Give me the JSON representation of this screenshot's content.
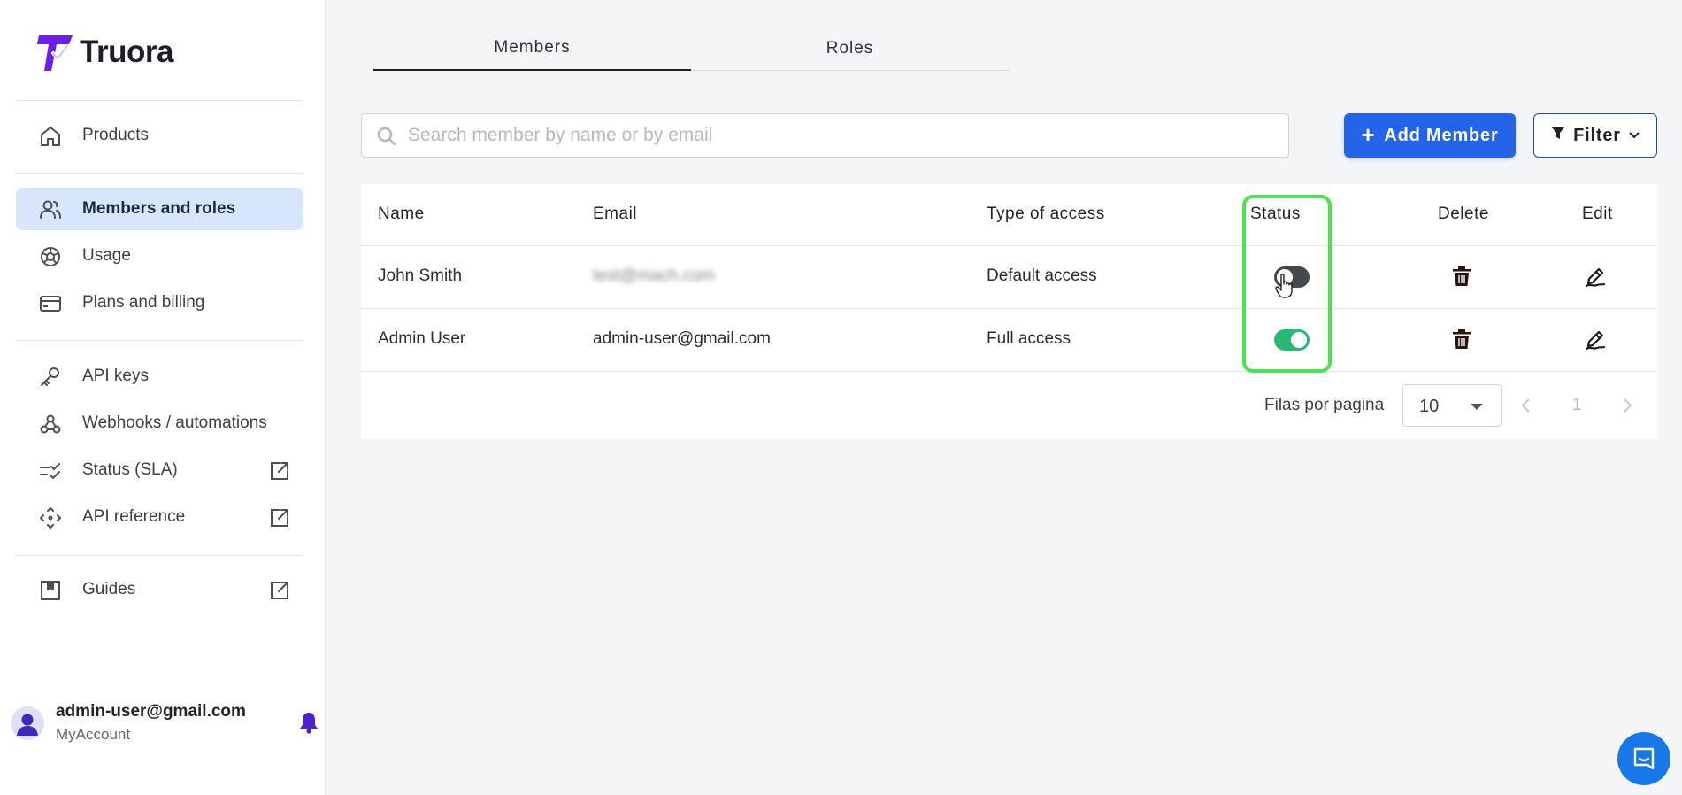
{
  "brand": {
    "name": "Truora",
    "color": "#6b1ee6"
  },
  "sidebar": {
    "items": [
      {
        "label": "Products",
        "icon": "home-icon"
      },
      {
        "label": "Members and roles",
        "icon": "users-icon",
        "active": true
      },
      {
        "label": "Usage",
        "icon": "usage-icon"
      },
      {
        "label": "Plans and billing",
        "icon": "credit-card-icon"
      },
      {
        "label": "API keys",
        "icon": "key-icon"
      },
      {
        "label": "Webhooks / automations",
        "icon": "webhook-icon"
      },
      {
        "label": "Status (SLA)",
        "icon": "checklist-icon",
        "external": true
      },
      {
        "label": "API reference",
        "icon": "api-arrows-icon",
        "external": true
      },
      {
        "label": "Guides",
        "icon": "bookmark-icon",
        "external": true
      }
    ],
    "account": {
      "email": "admin-user@gmail.com",
      "subtitle": "MyAccount"
    }
  },
  "tabs": [
    {
      "label": "Members",
      "active": true
    },
    {
      "label": "Roles",
      "active": false
    }
  ],
  "search": {
    "placeholder": "Search member by name or by email",
    "value": ""
  },
  "toolbar": {
    "add_label": "Add Member",
    "filter_label": "Filter"
  },
  "table": {
    "headers": {
      "name": "Name",
      "email": "Email",
      "access": "Type of access",
      "status": "Status",
      "delete": "Delete",
      "edit": "Edit"
    },
    "rows": [
      {
        "name": "John Smith",
        "email": "test@mach.com",
        "access": "Default access",
        "status": "inactive"
      },
      {
        "name": "Admin User",
        "email": "admin-user@gmail.com",
        "access": "Full access",
        "status": "active"
      }
    ]
  },
  "pagination": {
    "rows_label": "Filas por pagina",
    "rows_per_page": "10",
    "page": "1"
  },
  "colors": {
    "primary": "#2563e8",
    "active_toggle": "#2bb673",
    "highlight": "#4ce24e",
    "sidebar_active": "#d8e6fb"
  }
}
